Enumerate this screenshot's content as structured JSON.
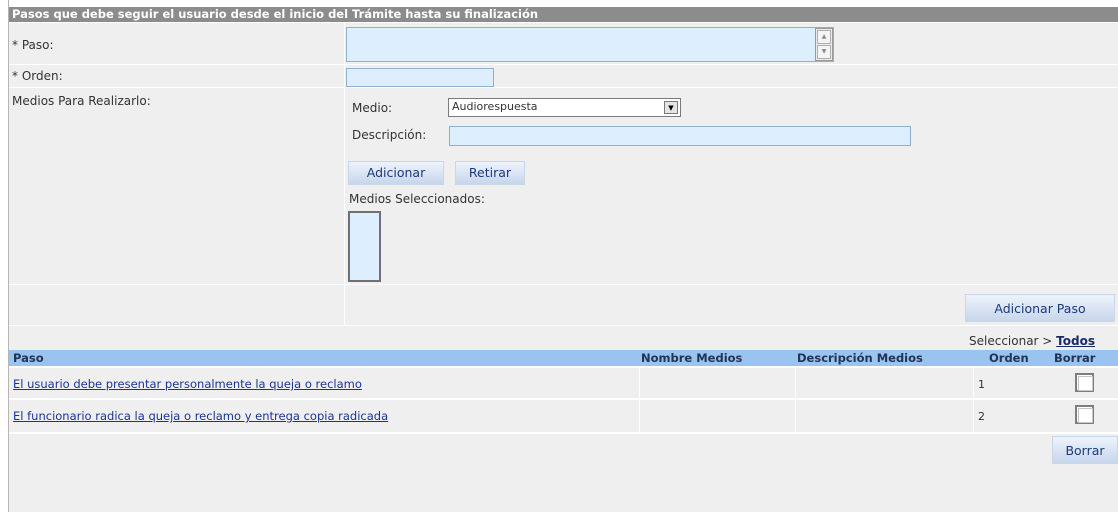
{
  "header": {
    "title": "Pasos que debe seguir el usuario desde el inicio del Trámite hasta su finalización"
  },
  "form": {
    "paso_label": "* Paso:",
    "paso_value": "",
    "orden_label": "* Orden:",
    "orden_value": "",
    "medios_label": "Medios Para Realizarlo:",
    "medio_label": "Medio:",
    "medio_selected": "Audiorespuesta",
    "descripcion_label": "Descripción:",
    "descripcion_value": "",
    "adicionar_label": "Adicionar",
    "retirar_label": "Retirar",
    "medios_seleccionados_label": "Medios Seleccionados:",
    "adicionar_paso_label": "Adicionar Paso"
  },
  "table": {
    "select_prefix": "Seleccionar > ",
    "select_all_label": "Todos",
    "columns": {
      "paso": "Paso",
      "nombre_medios": "Nombre Medios",
      "descripcion_medios": "Descripción Medios",
      "orden": "Orden",
      "borrar": "Borrar"
    },
    "rows": [
      {
        "paso": "El usuario debe presentar personalmente la queja o reclamo",
        "nombre_medios": "",
        "descripcion_medios": "",
        "orden": "1",
        "checked": false
      },
      {
        "paso": "El funcionario radica la queja o reclamo y entrega copia radicada",
        "nombre_medios": "",
        "descripcion_medios": "",
        "orden": "2",
        "checked": false
      }
    ],
    "borrar_button_label": "Borrar"
  },
  "icons": {
    "select_arrow": "chevron-down-icon",
    "scroll_up": "scroll-up-icon",
    "scroll_down": "scroll-down-icon"
  },
  "colors": {
    "header_bg": "#8c8c8c",
    "table_header_bg": "#99c4ef",
    "field_bg": "#ddeeff",
    "row_bg": "#efefef",
    "link": "#1a3399"
  }
}
